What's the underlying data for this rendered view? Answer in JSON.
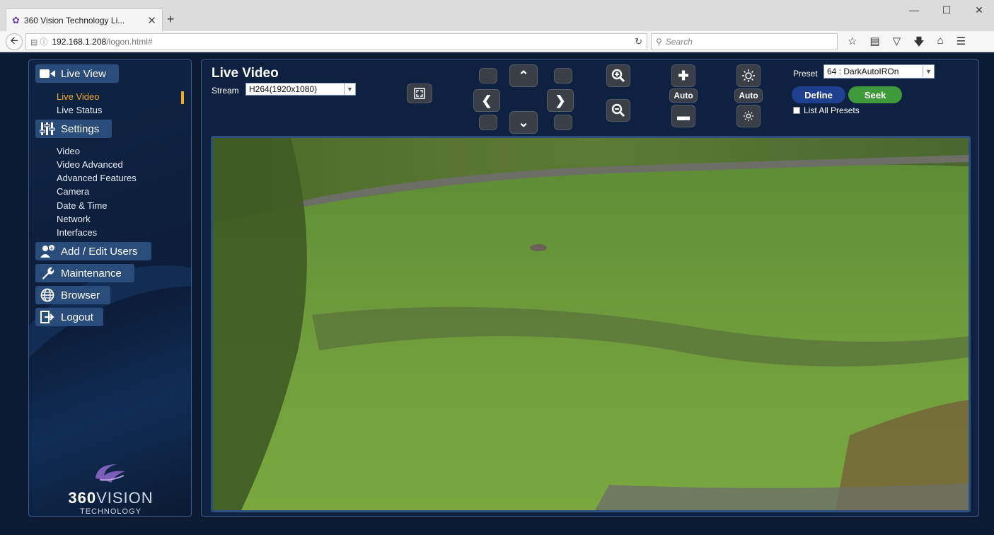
{
  "browser": {
    "tab_title": "360 Vision Technology Li...",
    "url_host": "192.168.1.208",
    "url_path": "/logon.html#",
    "search_placeholder": "Search"
  },
  "sidebar": {
    "sections": [
      {
        "label": "Live View",
        "icon": "video-camera-icon"
      },
      {
        "label": "Settings",
        "icon": "sliders-icon"
      },
      {
        "label": "Add / Edit Users",
        "icon": "add-user-icon"
      },
      {
        "label": "Maintenance",
        "icon": "wrench-icon"
      },
      {
        "label": "Browser",
        "icon": "globe-icon"
      },
      {
        "label": "Logout",
        "icon": "logout-icon"
      }
    ],
    "live_view_items": [
      "Live Video",
      "Live Status"
    ],
    "settings_items": [
      "Video",
      "Video Advanced",
      "Advanced Features",
      "Camera",
      "Date & Time",
      "Network",
      "Interfaces"
    ],
    "logo": {
      "brand_bold": "360",
      "brand_thin": "VISION",
      "sub": "TECHNOLOGY"
    }
  },
  "main": {
    "title": "Live Video",
    "stream_label": "Stream",
    "stream_value": "H264(1920x1080)",
    "auto_focus_label": "Auto",
    "auto_iris_label": "Auto",
    "preset_label": "Preset",
    "preset_value": "64 : DarkAutoIROn",
    "define_label": "Define",
    "seek_label": "Seek",
    "list_all_presets_label": "List All Presets"
  },
  "colors": {
    "accent_active": "#f5a623",
    "define_button": "#1f3f8f",
    "seek_button": "#3f9b3a",
    "section_button": "#2a4c7a"
  }
}
